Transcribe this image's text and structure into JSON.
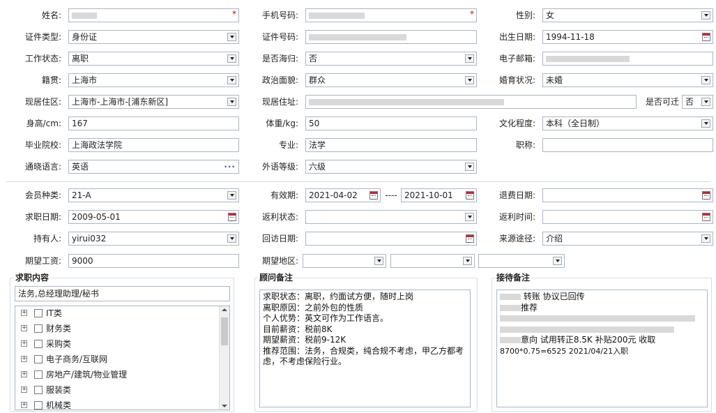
{
  "form": {
    "name_label": "姓名:",
    "name_value": "",
    "phone_label": "手机号码:",
    "phone_value": "",
    "gender_label": "性别:",
    "gender_value": "女",
    "idtype_label": "证件类型:",
    "idtype_value": "身份证",
    "idno_label": "证件号码:",
    "idno_value": "",
    "birth_label": "出生日期:",
    "birth_value": "1994-11-18",
    "workstatus_label": "工作状态:",
    "workstatus_value": "离职",
    "returnee_label": "是否海归:",
    "returnee_value": "否",
    "email_label": "电子邮箱:",
    "email_value": "",
    "native_label": "籍贯:",
    "native_value": "上海市",
    "political_label": "政治面貌:",
    "political_value": "群众",
    "marital_label": "婚育状况:",
    "marital_value": "未婚",
    "residence_label": "现居住区:",
    "residence_value": "上海市-上海市-[浦东新区]",
    "address_label": "现居住址:",
    "address_value": "",
    "relocate_label": "是否可迁",
    "relocate_value": "否",
    "height_label": "身高/cm:",
    "height_value": "167",
    "weight_label": "体重/kg:",
    "weight_value": "50",
    "education_label": "文化程度:",
    "education_value": "本科（全日制）",
    "school_label": "毕业院校:",
    "school_value": "上海政法学院",
    "major_label": "专业:",
    "major_value": "法学",
    "title_label": "职称:",
    "title_value": "",
    "language_label": "通晓语言:",
    "language_value": "英语",
    "foreignlevel_label": "外语等级:",
    "foreignlevel_value": "六级"
  },
  "member": {
    "type_label": "会员种类:",
    "type_value": "21-A",
    "valid_label": "有效期:",
    "valid_from": "2021-04-02",
    "valid_sep": "----",
    "valid_to": "2021-10-01",
    "refund_label": "退费日期:",
    "refund_value": "",
    "jobdate_label": "求职日期:",
    "jobdate_value": "2009-05-01",
    "rebate_status_label": "返利状态:",
    "rebate_status_value": "",
    "rebate_time_label": "返利时间:",
    "rebate_time_value": "",
    "holder_label": "持有人:",
    "holder_value": "yirui032",
    "visit_label": "回访日期:",
    "visit_value": "",
    "source_label": "来源途径:",
    "source_value": "介绍",
    "salary_label": "期望工资:",
    "salary_value": "9000",
    "area_label": "期望地区:",
    "area1": "",
    "area2": "",
    "area3": ""
  },
  "job_panel": {
    "title": "求职内容",
    "selected": "法务,总经理助理/秘书",
    "items": [
      "IT类",
      "财务类",
      "采购类",
      "电子商务/互联网",
      "房地产/建筑/物业管理",
      "服装类",
      "机械类"
    ]
  },
  "consultant_panel": {
    "title": "顾问备注",
    "text": "求职状态：离职，约面试方便，随时上岗\n离职原因：之前外包的性质\n个人优势：英文可作为工作语言。\n目前薪资：税前8K\n期望薪资：税前9-12K\n推荐范围：法务，合规类，纯合规不考虑，甲乙方都考虑，不考虑保险行业。"
  },
  "reception_panel": {
    "title": "接待备注",
    "line1": "转账 协议已回传",
    "line2": "推荐",
    "line3": "意向 试用转正8.5K  补贴200元 收取",
    "line4": "8700*0.75=6525  2021/04/21入职"
  },
  "colors": {
    "border": "#a7b7c7",
    "required": "#dd0000",
    "panel_border": "#d7dde4"
  },
  "icons": [
    "dropdown-arrow-icon",
    "calendar-icon",
    "ellipsis-icon",
    "expand-plus-icon",
    "checkbox-icon"
  ]
}
